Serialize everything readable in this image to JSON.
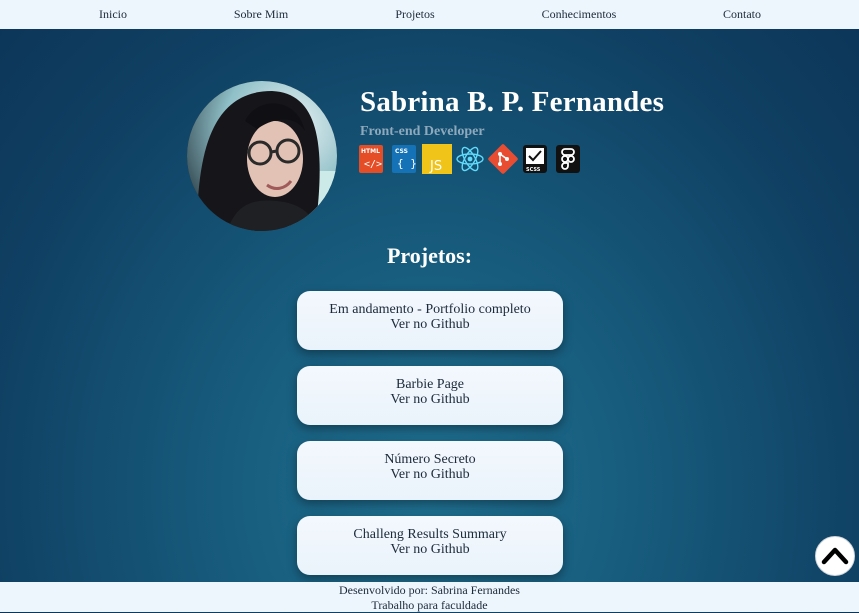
{
  "nav": {
    "items": [
      {
        "label": "Inicio"
      },
      {
        "label": "Sobre Mim"
      },
      {
        "label": "Projetos"
      },
      {
        "label": "Conhecimentos"
      },
      {
        "label": "Contato"
      }
    ]
  },
  "profile": {
    "name": "Sabrina B. P. Fernandes",
    "role": "Front-end Developer"
  },
  "skills": [
    {
      "icon": "html-icon",
      "label": "HTML",
      "color": "#e44d26"
    },
    {
      "icon": "css-icon",
      "label": "CSS",
      "color": "#1572b6"
    },
    {
      "icon": "javascript-icon",
      "label": "JS",
      "color": "#f0c419"
    },
    {
      "icon": "react-icon",
      "color": "#61dafb"
    },
    {
      "icon": "git-icon",
      "color": "#e84d31"
    },
    {
      "icon": "sass-icon",
      "label": "SCSS",
      "color": "#111111"
    },
    {
      "icon": "figma-icon",
      "color": "#111111"
    }
  ],
  "projects": {
    "title": "Projetos:",
    "items": [
      {
        "title": "Em andamento - Portfolio completo",
        "link": "Ver no Github"
      },
      {
        "title": "Barbie Page",
        "link": "Ver no Github"
      },
      {
        "title": "Número Secreto",
        "link": "Ver no Github"
      },
      {
        "title": "Challeng Results Summary",
        "link": "Ver no Github"
      }
    ]
  },
  "scroll_top": {
    "icon": "chevron-up-icon"
  },
  "footer": {
    "line1": "Desenvolvido por: Sabrina Fernandes",
    "line2": "Trabalho para faculdade"
  }
}
